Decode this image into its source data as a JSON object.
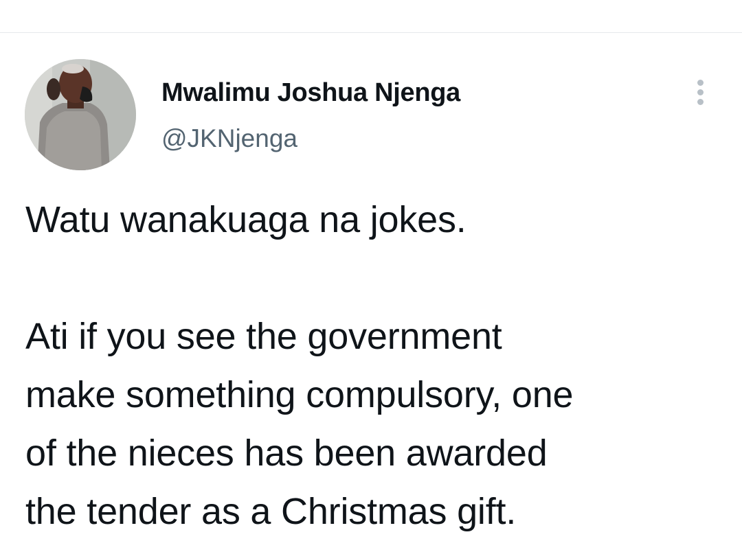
{
  "tweet": {
    "author": {
      "display_name": "Mwalimu Joshua Njenga",
      "handle": "@JKNjenga",
      "avatar_icon": "profile-photo"
    },
    "more_icon": "more-vertical-icon",
    "text_lines": [
      "Watu wanakuaga na jokes.",
      "",
      "Ati if you see the government",
      "make something compulsory, one",
      "of the nieces has been awarded",
      "the tender as a Christmas gift."
    ]
  },
  "colors": {
    "text_primary": "#0f1419",
    "text_secondary": "#536471",
    "divider": "#e6e9eb",
    "icon_muted": "#b8c0c7"
  }
}
